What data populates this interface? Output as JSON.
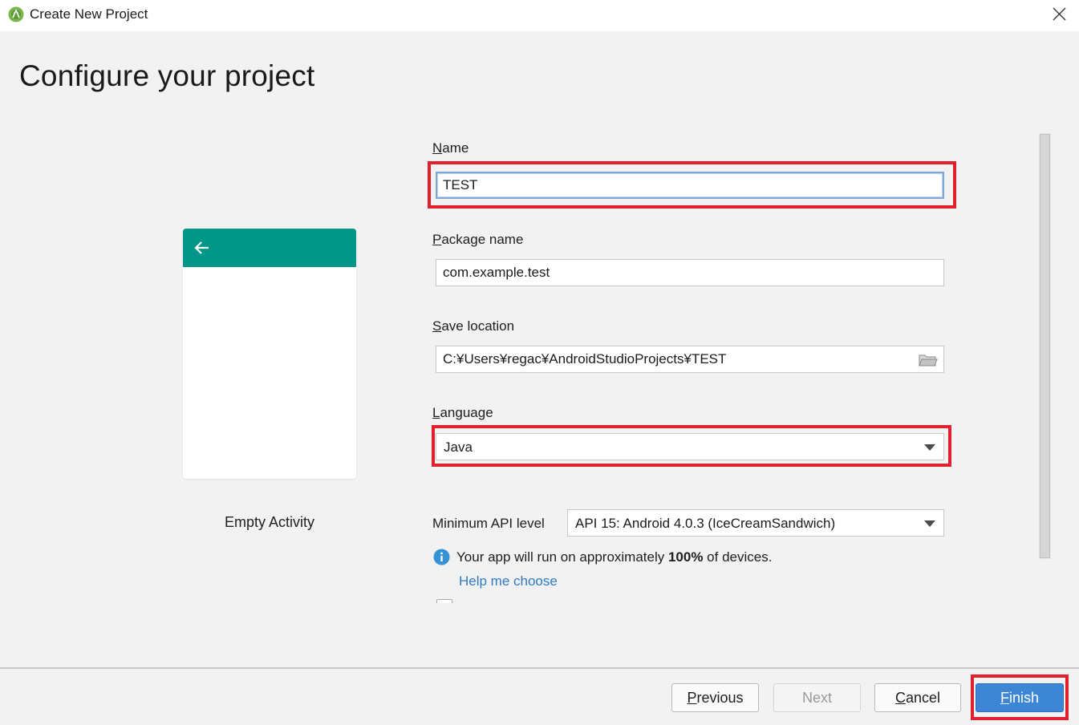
{
  "window": {
    "title": "Create New Project",
    "page_title": "Configure your project"
  },
  "preview": {
    "template_label": "Empty Activity",
    "appbar_color": "#009688"
  },
  "form": {
    "name": {
      "label_first": "N",
      "label_rest": "ame",
      "value": "TEST"
    },
    "package": {
      "label_first": "P",
      "label_rest": "ackage name",
      "value": "com.example.test"
    },
    "save_location": {
      "label_first": "S",
      "label_rest": "ave location",
      "value": "C:¥Users¥regac¥AndroidStudioProjects¥TEST"
    },
    "language": {
      "label_first": "L",
      "label_rest": "anguage",
      "value": "Java"
    },
    "min_api": {
      "label": "Minimum API level",
      "value": "API 15: Android 4.0.3 (IceCreamSandwich)"
    },
    "info": {
      "prefix": "Your app will run on approximately ",
      "percent": "100%",
      "suffix": " of devices."
    },
    "help_link": "Help me choose"
  },
  "buttons": {
    "previous": {
      "first": "P",
      "rest": "revious"
    },
    "next": "Next",
    "cancel": {
      "first": "C",
      "rest": "ancel"
    },
    "finish": {
      "first": "F",
      "rest": "inish"
    }
  },
  "colors": {
    "highlight": "#e0202c",
    "link": "#2e7bc4",
    "finish_button": "#3d86d6",
    "info_icon": "#3592d4"
  }
}
